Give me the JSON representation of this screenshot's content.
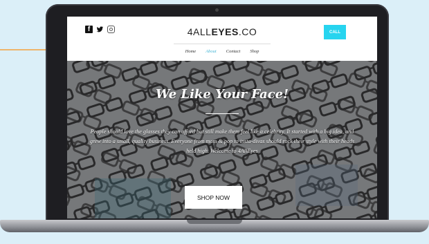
{
  "header": {
    "brand_light": "4ALL",
    "brand_bold": "EYES",
    "brand_suffix": ".CO",
    "call_label": "CALL",
    "social": [
      "facebook-icon",
      "twitter-icon",
      "instagram-icon"
    ]
  },
  "nav": {
    "items": [
      {
        "label": "Home",
        "active": false
      },
      {
        "label": "About",
        "active": true
      },
      {
        "label": "Contact",
        "active": false
      },
      {
        "label": "Shop",
        "active": false
      }
    ]
  },
  "hero": {
    "title": "We Like Your Face!",
    "text": "People should love the glasses they can afford but still make them feel like a celebrity. It started with a big idea, and grew into a small, quality business. Everyone from mom & pop to insta-divas should rock their style with their heads held high. Welcome to 4AllEyes",
    "button_label": "SHOP NOW"
  },
  "colors": {
    "background": "#dbeff8",
    "accent": "#27d4ef",
    "arrow": "#f5a03a",
    "nav_active": "#49b7d6"
  }
}
